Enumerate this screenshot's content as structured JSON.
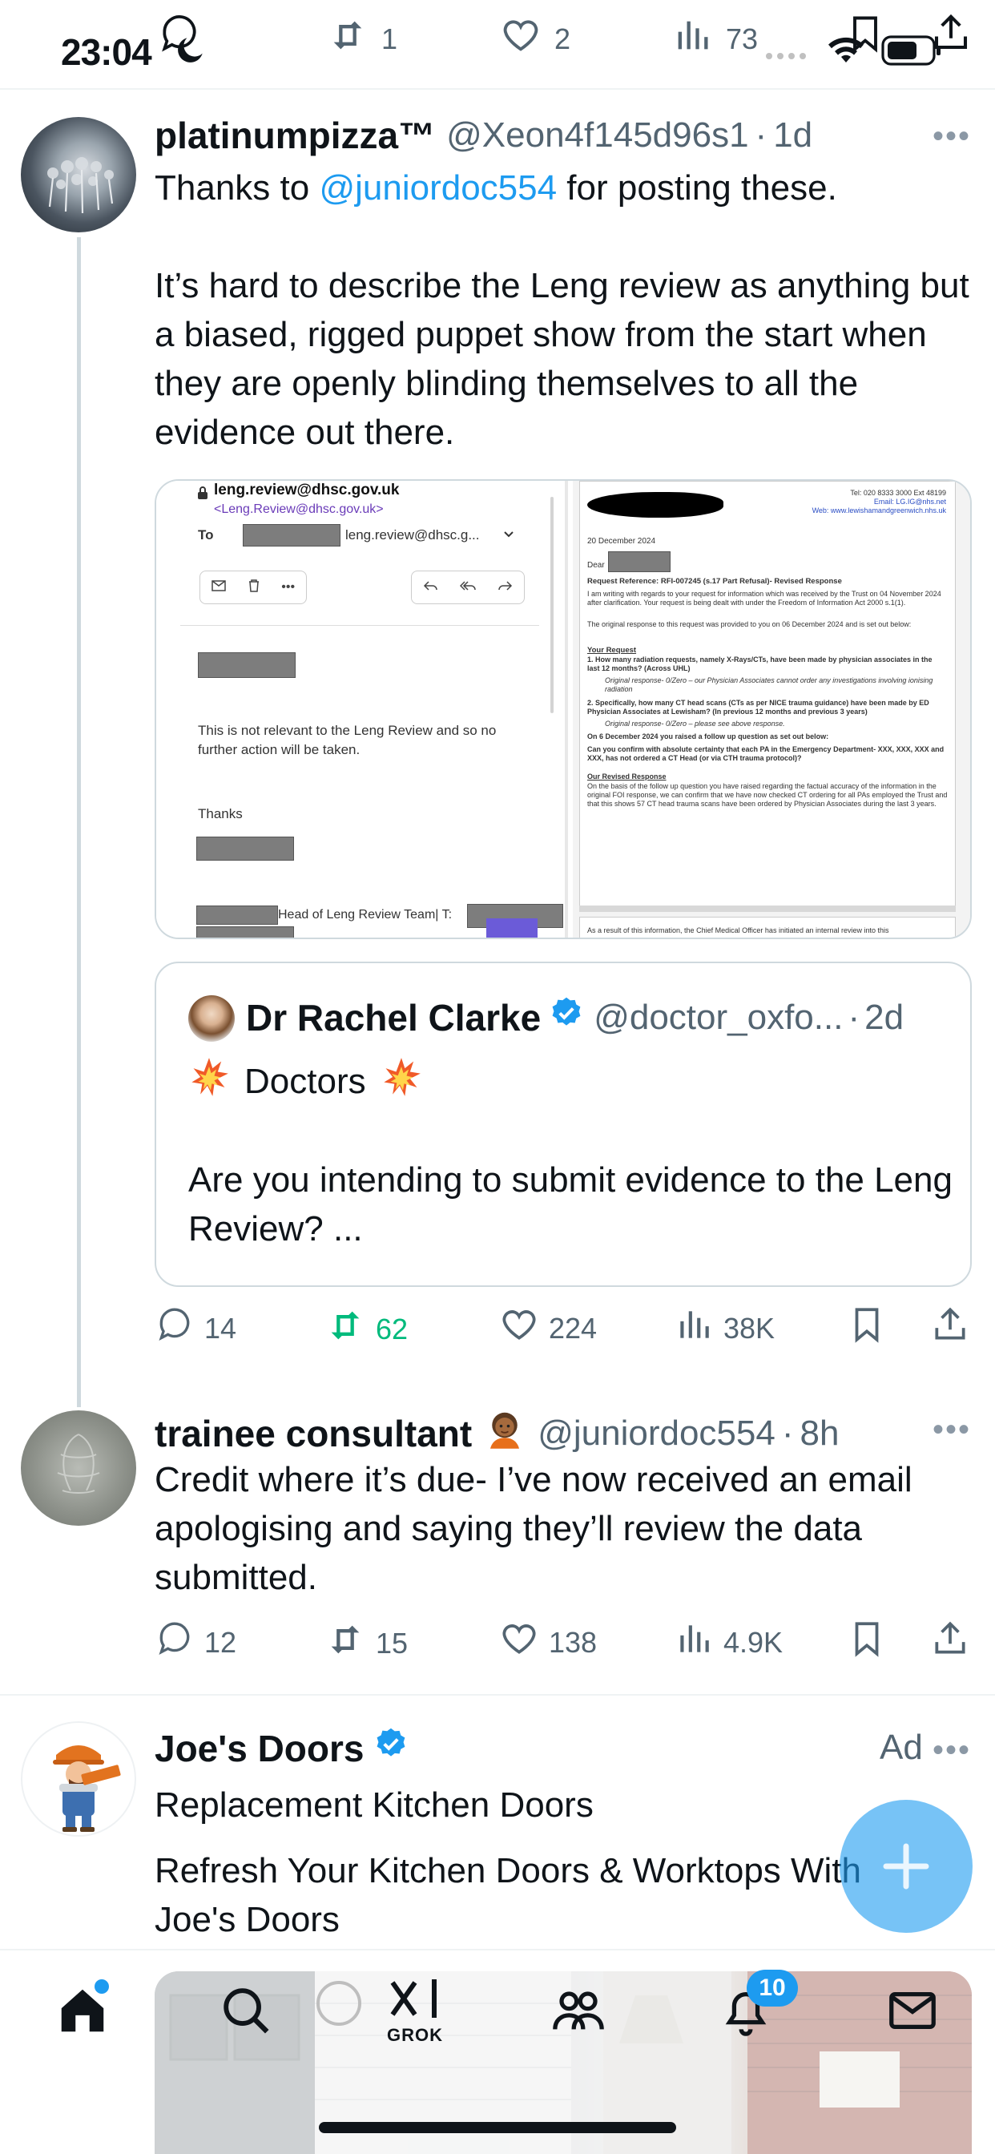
{
  "status_bar": {
    "time": "23:04"
  },
  "top_stats": {
    "retweets": "1",
    "likes": "2",
    "views": "73"
  },
  "tweet1": {
    "display_name": "platinumpizza™",
    "handle": "@Xeon4f145d96s1",
    "time": "1d",
    "text_prefix": "Thanks to ",
    "mention": "@juniordoc554",
    "text_suffix": " for posting these.",
    "paragraph": "It’s hard to describe the Leng review as anything but a biased, rigged puppet show from the start when they are openly blinding themselves to all the evidence out there.",
    "media_left": {
      "from_email": "leng.review@dhsc.gov.uk",
      "from_sub": "<Leng.Review@dhsc.gov.uk>",
      "to_label": "To",
      "to_value": "leng.review@dhsc.g...",
      "message": "This is not relevant to the Leng Review and so no further action will be taken.",
      "thanks": "Thanks",
      "signature": "Head of Leng Review Team| T:"
    },
    "media_right": {
      "tel": "Tel: 020 8333 3000 Ext 48199",
      "email": "Email: LG.IG@nhs.net",
      "web": "Web: www.lewishamandgreenwich.nhs.uk",
      "date": "20 December 2024",
      "dear": "Dear",
      "reference": "Request Reference: RFI-007245 (s.17 Part Refusal)- Revised Response",
      "intro": "I am writing with regards to your request for information which was received by the Trust on 04 November 2024 after clarification. Your request is being dealt with under the Freedom of Information Act 2000 s.1(1).",
      "original": "The original response to this request was provided to you on 06 December 2024 and is set out below:",
      "your_request": "Your Request",
      "q1": "1.  How many radiation requests, namely X-Rays/CTs, have been made by physician associates in the last 12 months? (Across UHL)",
      "a1": "Original response- 0/Zero – our Physician Associates cannot order any investigations involving ionising radiation",
      "q2": "2.  Specifically, how many CT head scans (CTs as per NICE trauma guidance) have been made by ED Physician Associates at Lewisham? (In previous 12 months and previous 3 years)",
      "a2": "Original response- 0/Zero – please see above response.",
      "followup": "On 6 December 2024 you raised a follow up question as set out below:",
      "q3": "Can you confirm with absolute certainty that each PA in the Emergency Department- XXX, XXX, XXX and XXX, has not ordered a CT Head (or via CTH trauma protocol)?",
      "revised": "Our Revised Response",
      "revised_text": "On the basis of the follow up question you have raised regarding the factual accuracy of the information in the original FOI response, we can confirm that we have now checked CT ordering for all PAs employed the Trust and that this shows 57 CT head trauma scans have been ordered by Physician Associates during the last 3 years.",
      "footer": "As a result of this information, the Chief Medical Officer has initiated an internal review into this"
    },
    "quote": {
      "display_name": "Dr Rachel Clarke",
      "handle": "@doctor_oxfo...",
      "time": "2d",
      "line1": "Doctors",
      "line2": "Are you intending to submit evidence to the Leng Review? ..."
    },
    "stats": {
      "replies": "14",
      "retweets": "62",
      "likes": "224",
      "views": "38K"
    }
  },
  "tweet2": {
    "display_name": "trainee consultant",
    "handle": "@juniordoc554",
    "time": "8h",
    "text": "Credit where it’s due- I’ve now received an email apologising and saying they’ll review the data submitted.",
    "stats": {
      "replies": "12",
      "retweets": "15",
      "likes": "138",
      "views": "4.9K"
    }
  },
  "ad": {
    "display_name": "Joe's Doors",
    "ad_label": "Ad",
    "headline": "Replacement Kitchen Doors",
    "text": "Refresh Your Kitchen Doors & Worktops With Joe's Doors"
  },
  "bottom_nav": {
    "grok_label": "GROK",
    "notification_count": "10"
  },
  "colors": {
    "accent": "#1d9bf0",
    "retweet_active": "#00ba7c",
    "muted": "#536471"
  }
}
